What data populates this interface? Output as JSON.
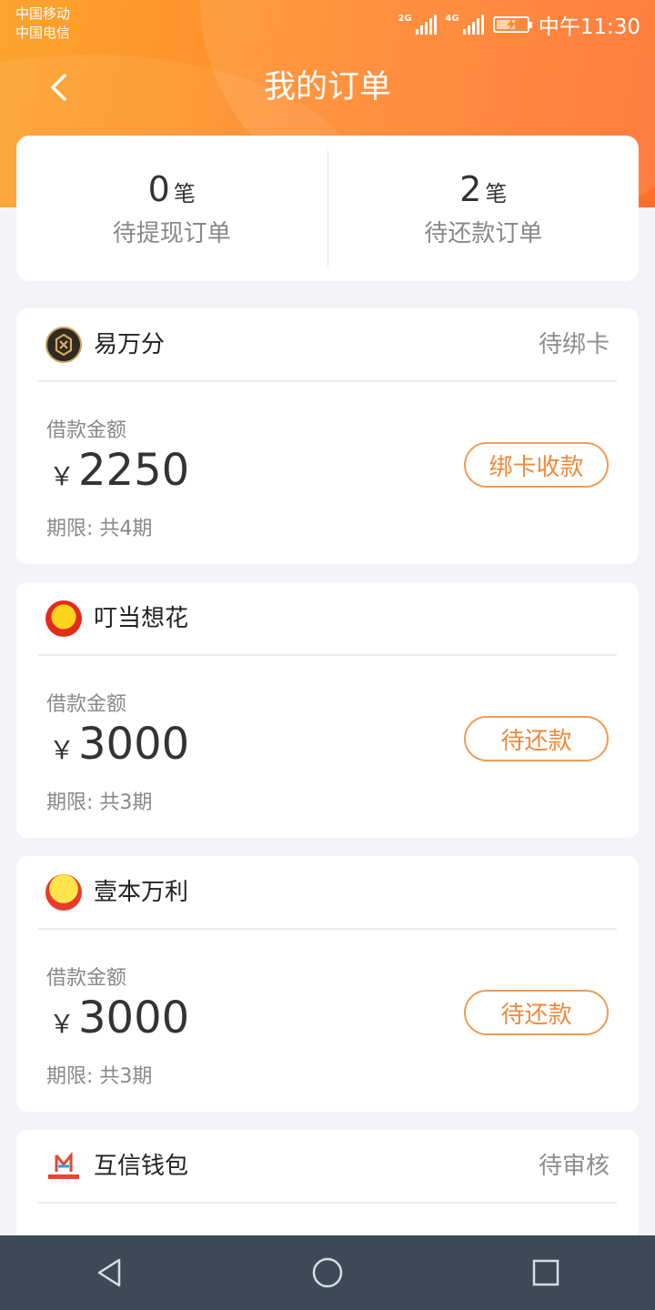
{
  "status_bar": {
    "carrier_1": "中国移动",
    "carrier_2": "中国电信",
    "signal_1_label": "2G",
    "signal_2_label": "4G",
    "time": "中午11:30"
  },
  "header": {
    "title": "我的订单",
    "back_icon": "chevron-left-icon"
  },
  "summary": {
    "left": {
      "count": "0",
      "unit": "笔",
      "label": "待提现订单"
    },
    "right": {
      "count": "2",
      "unit": "笔",
      "label": "待还款订单"
    }
  },
  "orders": [
    {
      "merchant": "易万分",
      "status": "待绑卡",
      "amount_label": "借款金额",
      "currency": "￥",
      "amount": "2250",
      "term": "期限: 共4期",
      "action": "绑卡收款"
    },
    {
      "merchant": "叮当想花",
      "status": "",
      "amount_label": "借款金额",
      "currency": "￥",
      "amount": "3000",
      "term": "期限: 共3期",
      "action": "待还款"
    },
    {
      "merchant": "壹本万利",
      "status": "",
      "amount_label": "借款金额",
      "currency": "￥",
      "amount": "3000",
      "term": "期限: 共3期",
      "action": "待还款"
    },
    {
      "merchant": "互信钱包",
      "status": "待审核"
    }
  ],
  "nav_bar": {
    "back_icon": "triangle-back-icon",
    "home_icon": "circle-home-icon",
    "recents_icon": "square-recents-icon"
  },
  "colors": {
    "header_orange": "#ff8a2a",
    "accent": "#ee8a3c",
    "nav_bg": "#3c4a58"
  }
}
